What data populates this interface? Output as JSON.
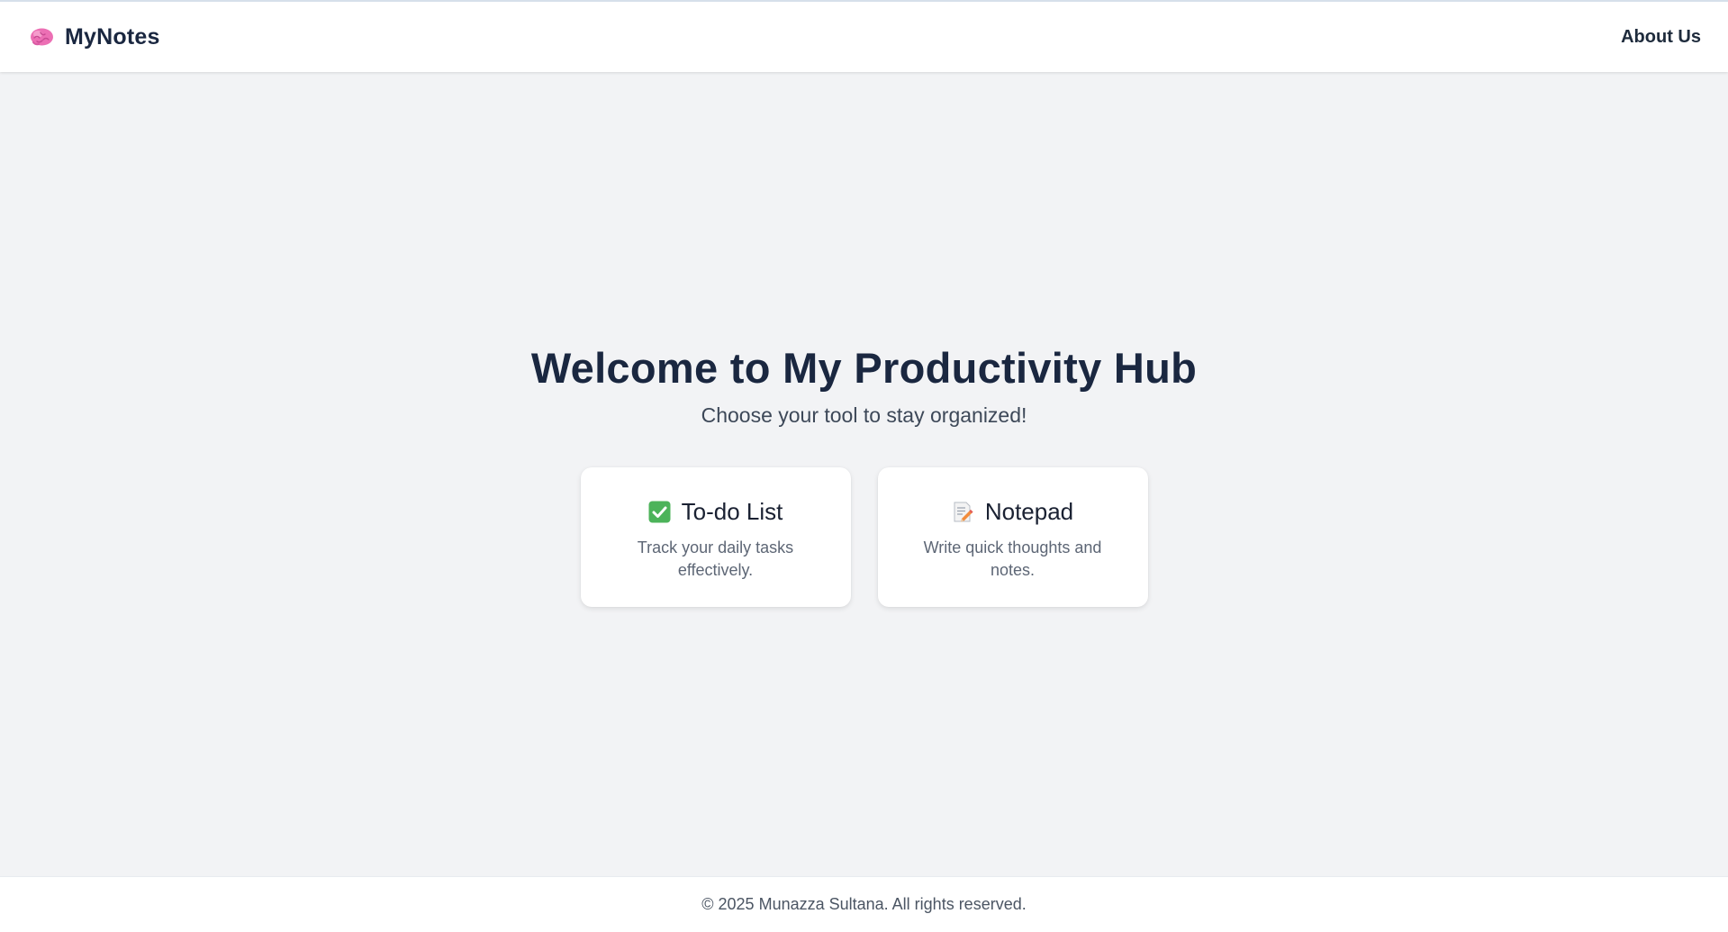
{
  "navbar": {
    "brand_icon": "brain-icon",
    "brand_name": "MyNotes",
    "links": [
      {
        "label": "About Us"
      }
    ]
  },
  "hero": {
    "title": "Welcome to My Productivity Hub",
    "subtitle": "Choose your tool to stay organized!"
  },
  "cards": [
    {
      "icon": "check-mark-button-icon",
      "title": "To-do List",
      "description": "Track your daily tasks effectively."
    },
    {
      "icon": "memo-icon",
      "title": "Notepad",
      "description": "Write quick thoughts and notes."
    }
  ],
  "footer": {
    "text": "© 2025 Munazza Sultana. All rights reserved."
  },
  "colors": {
    "background": "#f2f3f5",
    "heading": "#1a2740",
    "brain_pink": "#ec6fb4",
    "check_green": "#4cb35a"
  }
}
